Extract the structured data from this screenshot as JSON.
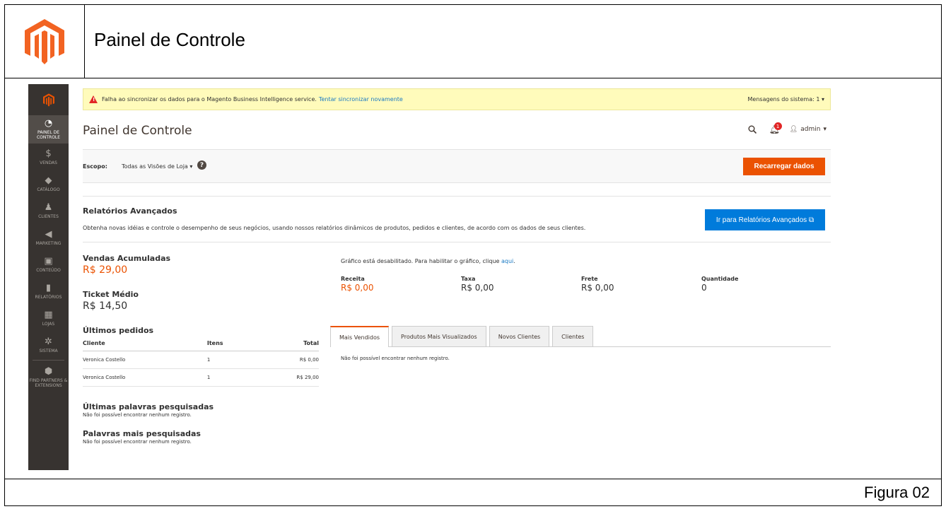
{
  "frame": {
    "title": "Painel de Controle",
    "caption": "Figura 02"
  },
  "sidebar": {
    "items": [
      {
        "label": "PAINEL DE CONTROLE",
        "icon": "gauge-icon"
      },
      {
        "label": "VENDAS",
        "icon": "dollar-icon"
      },
      {
        "label": "CATÁLOGO",
        "icon": "box-icon"
      },
      {
        "label": "CLIENTES",
        "icon": "person-icon"
      },
      {
        "label": "MARKETING",
        "icon": "megaphone-icon"
      },
      {
        "label": "CONTEÚDO",
        "icon": "layout-icon"
      },
      {
        "label": "RELATÓRIOS",
        "icon": "bars-icon"
      },
      {
        "label": "LOJAS",
        "icon": "store-icon"
      },
      {
        "label": "SISTEMA",
        "icon": "gear-icon"
      },
      {
        "label": "FIND PARTNERS & EXTENSIONS",
        "icon": "cube-icon"
      }
    ]
  },
  "alert": {
    "message": "Falha ao sincronizar os dados para o Magento Business Intelligence service.",
    "link": "Tentar sincronizar novamente",
    "system_messages": "Mensagens do sistema: 1"
  },
  "header": {
    "title": "Painel de Controle",
    "notifications": "1",
    "user": "admin"
  },
  "scope": {
    "label": "Escopo:",
    "value": "Todas as Visões de Loja",
    "reload": "Recarregar dados"
  },
  "advanced": {
    "title": "Relatórios Avançados",
    "text": "Obtenha novas idéias e controle o desempenho de seus negócios, usando nossos relatórios dinâmicos de produtos, pedidos e clientes, de acordo com os dados de seus clientes.",
    "button": "Ir para Relatórios Avançados"
  },
  "kpis": {
    "sales_label": "Vendas Acumuladas",
    "sales_value": "R$ 29,00",
    "ticket_label": "Ticket Médio",
    "ticket_value": "R$ 14,50"
  },
  "orders": {
    "title": "Últimos pedidos",
    "headers": {
      "customer": "Cliente",
      "items": "Itens",
      "total": "Total"
    },
    "rows": [
      {
        "customer": "Veronica Costello",
        "items": "1",
        "total": "R$ 0,00"
      },
      {
        "customer": "Veronica Costello",
        "items": "1",
        "total": "R$ 29,00"
      }
    ]
  },
  "last_searches": {
    "title": "Últimas palavras pesquisadas",
    "empty": "Não foi possível encontrar nenhum registro."
  },
  "top_searches": {
    "title": "Palavras mais pesquisadas",
    "empty": "Não foi possível encontrar nenhum registro."
  },
  "chart": {
    "disabled_text": "Gráfico está desabilitado. Para habilitar o gráfico, clique",
    "link": "aqui",
    "dot": "."
  },
  "totals": {
    "revenue_label": "Receita",
    "revenue_value": "R$ 0,00",
    "tax_label": "Taxa",
    "tax_value": "R$ 0,00",
    "shipping_label": "Frete",
    "shipping_value": "R$ 0,00",
    "qty_label": "Quantidade",
    "qty_value": "0"
  },
  "tabs": {
    "items": [
      "Mais Vendidos",
      "Produtos Mais Visualizados",
      "Novos Clientes",
      "Clientes"
    ],
    "empty": "Não foi possível encontrar nenhum registro."
  },
  "colors": {
    "accent": "#eb5202",
    "link": "#1979c3",
    "sidebar": "#373330",
    "button_blue": "#007bdb"
  }
}
